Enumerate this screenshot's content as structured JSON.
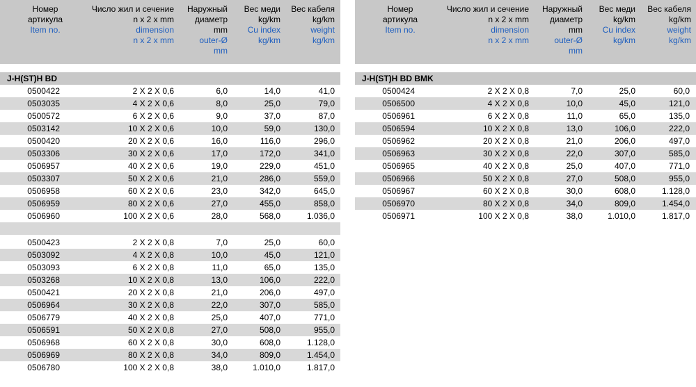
{
  "header": {
    "col0_ru": "Номер\nартикула",
    "col0_en": "Item no.",
    "col1_ru": "Число жил и сечение\nn x 2 x mm",
    "col1_en": "dimension\nn x 2 x mm",
    "col2_ru": "Наружный\nдиаметр\nmm",
    "col2_en": "outer-Ø\nmm",
    "col3_ru": "Вес меди\nkg/km",
    "col3_en": "Cu index\nkg/km",
    "col4_ru": "Вес кабеля\nkg/km",
    "col4_en": "weight\nkg/km"
  },
  "left": {
    "title": "J-H(ST)H BD",
    "group1": [
      [
        "0500422",
        "2 X 2 X 0,6",
        "6,0",
        "14,0",
        "41,0"
      ],
      [
        "0503035",
        "4 X 2 X 0,6",
        "8,0",
        "25,0",
        "79,0"
      ],
      [
        "0500572",
        "6 X 2 X 0,6",
        "9,0",
        "37,0",
        "87,0"
      ],
      [
        "0503142",
        "10 X 2 X 0,6",
        "10,0",
        "59,0",
        "130,0"
      ],
      [
        "0500420",
        "20 X 2 X 0,6",
        "16,0",
        "116,0",
        "296,0"
      ],
      [
        "0503306",
        "30 X 2 X 0,6",
        "17,0",
        "172,0",
        "341,0"
      ],
      [
        "0506957",
        "40 X 2 X 0,6",
        "19,0",
        "229,0",
        "451,0"
      ],
      [
        "0503307",
        "50 X 2 X 0,6",
        "21,0",
        "286,0",
        "559,0"
      ],
      [
        "0506958",
        "60 X 2 X 0,6",
        "23,0",
        "342,0",
        "645,0"
      ],
      [
        "0506959",
        "80 X 2 X 0,6",
        "27,0",
        "455,0",
        "858,0"
      ],
      [
        "0506960",
        "100 X 2 X 0,6",
        "28,0",
        "568,0",
        "1.036,0"
      ]
    ],
    "group2": [
      [
        "0500423",
        "2 X 2 X 0,8",
        "7,0",
        "25,0",
        "60,0"
      ],
      [
        "0503092",
        "4 X 2 X 0,8",
        "10,0",
        "45,0",
        "121,0"
      ],
      [
        "0503093",
        "6 X 2 X 0,8",
        "11,0",
        "65,0",
        "135,0"
      ],
      [
        "0503268",
        "10 X 2 X 0,8",
        "13,0",
        "106,0",
        "222,0"
      ],
      [
        "0500421",
        "20 X 2 X 0,8",
        "21,0",
        "206,0",
        "497,0"
      ],
      [
        "0506964",
        "30 X 2 X 0,8",
        "22,0",
        "307,0",
        "585,0"
      ],
      [
        "0506779",
        "40 X 2 X 0,8",
        "25,0",
        "407,0",
        "771,0"
      ],
      [
        "0506591",
        "50 X 2 X 0,8",
        "27,0",
        "508,0",
        "955,0"
      ],
      [
        "0506968",
        "60 X 2 X 0,8",
        "30,0",
        "608,0",
        "1.128,0"
      ],
      [
        "0506969",
        "80 X 2 X 0,8",
        "34,0",
        "809,0",
        "1.454,0"
      ],
      [
        "0506780",
        "100 X 2 X 0,8",
        "38,0",
        "1.010,0",
        "1.817,0"
      ]
    ]
  },
  "right": {
    "title": "J-H(ST)H BD BMK",
    "group1": [
      [
        "0500424",
        "2 X 2 X 0,8",
        "7,0",
        "25,0",
        "60,0"
      ],
      [
        "0506500",
        "4 X 2 X 0,8",
        "10,0",
        "45,0",
        "121,0"
      ],
      [
        "0506961",
        "6 X 2 X 0,8",
        "11,0",
        "65,0",
        "135,0"
      ],
      [
        "0506594",
        "10 X 2 X 0,8",
        "13,0",
        "106,0",
        "222,0"
      ],
      [
        "0506962",
        "20 X 2 X 0,8",
        "21,0",
        "206,0",
        "497,0"
      ],
      [
        "0506963",
        "30 X 2 X 0,8",
        "22,0",
        "307,0",
        "585,0"
      ],
      [
        "0506965",
        "40 X 2 X 0,8",
        "25,0",
        "407,0",
        "771,0"
      ],
      [
        "0506966",
        "50 X 2 X 0,8",
        "27,0",
        "508,0",
        "955,0"
      ],
      [
        "0506967",
        "60 X 2 X 0,8",
        "30,0",
        "608,0",
        "1.128,0"
      ],
      [
        "0506970",
        "80 X 2 X 0,8",
        "34,0",
        "809,0",
        "1.454,0"
      ],
      [
        "0506971",
        "100 X 2 X 0,8",
        "38,0",
        "1.010,0",
        "1.817,0"
      ]
    ]
  }
}
